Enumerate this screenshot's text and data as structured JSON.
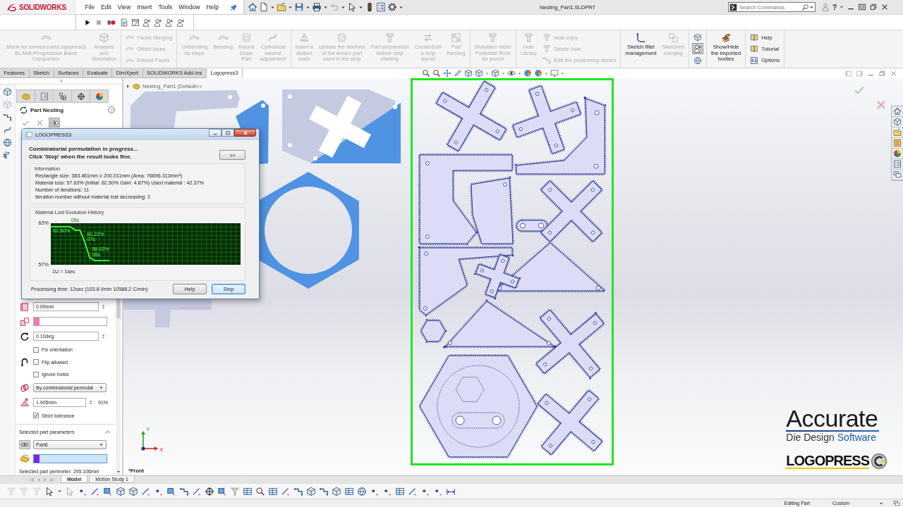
{
  "app_bar": {
    "logo": "SOLIDWORKS",
    "menus": [
      "File",
      "Edit",
      "View",
      "Insert",
      "Tools",
      "Window",
      "Help"
    ],
    "title": "Nesting_Part1.SLDPRT",
    "search": {
      "placeholder": "Search Commands"
    },
    "help": "?"
  },
  "ribbon": {
    "groups": [
      [
        {
          "kind": "large",
          "label": "Blank for formed part/Logopress3\nBLANK/Progressive Blank\nCompanion",
          "disabled": true
        },
        {
          "kind": "large",
          "label": "Analysis\nand\nSimulation",
          "disabled": true
        }
      ],
      [
        {
          "kind": "stack",
          "entries": [
            {
              "label": "Faces Merging",
              "disabled": true
            },
            {
              "label": "Offset faces",
              "disabled": true
            },
            {
              "label": "Extend Faces",
              "disabled": true
            }
          ]
        }
      ],
      [
        {
          "kind": "large",
          "label": "Unbending\nby steps",
          "disabled": true
        },
        {
          "kind": "large",
          "label": "Bending",
          "disabled": true
        },
        {
          "kind": "large",
          "label": "Round\nDraw\nPart",
          "disabled": true
        },
        {
          "kind": "large",
          "label": "Cylindrical\nvolume\nadjustment",
          "disabled": true
        }
      ],
      [
        {
          "kind": "large",
          "label": "Insert a\nstation\nmark",
          "disabled": true
        },
        {
          "kind": "large",
          "label": "Update the stations\nof the Annex part\nused in the strip",
          "disabled": true
        },
        {
          "kind": "large",
          "label": "Part preparation\nbefore strip\nstarting",
          "disabled": true
        },
        {
          "kind": "large",
          "label": "Create/Edit\na strip\nlayout",
          "disabled": true
        },
        {
          "kind": "large",
          "label": "Part\nNesting",
          "disabled": true
        }
      ],
      [
        {
          "kind": "large",
          "label": "Shoulder/ Heel/\nPedestal/ Roof\nfor punch",
          "disabled": true
        }
      ],
      [
        {
          "kind": "large",
          "label": "Hole\nLibrary",
          "disabled": true
        },
        {
          "kind": "stack",
          "entries": [
            {
              "label": "Hole copy",
              "disabled": true
            },
            {
              "label": "Delete hole",
              "disabled": true
            },
            {
              "label": "Edit the positioning sketch",
              "disabled": true
            }
          ]
        }
      ],
      [
        {
          "kind": "large",
          "label": "Sketch fillet\nmanagement",
          "disabled": false
        },
        {
          "kind": "large",
          "label": "Sketches\nmerging",
          "disabled": true
        }
      ],
      [
        {
          "kind": "toggles",
          "entries": [
            {
              "selected": false
            },
            {
              "selected": true
            },
            {
              "selected": false
            }
          ]
        }
      ],
      [
        {
          "kind": "large",
          "label": "Show/Hide\nthe imported\nbodies",
          "disabled": false
        }
      ],
      [
        {
          "kind": "stack",
          "entries": [
            {
              "label": "Help",
              "disabled": false
            },
            {
              "label": "Tutorial",
              "disabled": false
            },
            {
              "label": "Options",
              "disabled": false
            }
          ]
        }
      ]
    ]
  },
  "tabs": [
    {
      "label": "Features",
      "selected": false
    },
    {
      "label": "Sketch",
      "selected": false
    },
    {
      "label": "Surfaces",
      "selected": false
    },
    {
      "label": "Evaluate",
      "selected": false
    },
    {
      "label": "DimXpert",
      "selected": false
    },
    {
      "label": "SOLIDWORKS Add-Ins",
      "selected": false
    },
    {
      "label": "Logopress3",
      "selected": true
    }
  ],
  "property_manager": {
    "title": "Part Nesting",
    "help": "?",
    "actions": [
      {
        "kind": "ok",
        "disabled": true
      },
      {
        "kind": "cancel",
        "disabled": true
      },
      {
        "kind": "preview",
        "disabled": false
      }
    ],
    "fields": [
      {
        "kind": "spinner",
        "value": "0.00mm"
      },
      {
        "kind": "selection",
        "color": "#f07ab8",
        "active": false
      },
      {
        "kind": "spinner",
        "value": "0.10deg"
      },
      {
        "kind": "checkbox",
        "label": "Fix orientation",
        "checked": false
      },
      {
        "kind": "checkbox",
        "label": "Flip allowed",
        "checked": false
      },
      {
        "kind": "checkbox",
        "label": "Ignore holes",
        "checked": false
      },
      {
        "kind": "dropdown",
        "value": "By combinatorial permutal"
      },
      {
        "kind": "spinner",
        "value": "1.905mm",
        "suffix": "91%"
      },
      {
        "kind": "checkbox",
        "label": "Strict tolerance",
        "checked": true
      }
    ],
    "section": {
      "title": "Selected part parameters",
      "expanded": true,
      "part": "Part6",
      "selection": {
        "color": "#7d22e6",
        "active": true
      },
      "perimeter": "Selected part perimeter: 295.106mm"
    }
  },
  "dialog": {
    "title": "LOGOPRESS3",
    "message": [
      "Combinatorial permutation in progress...",
      "Click 'Stop' when the result looks fine."
    ],
    "expand_button": ">>",
    "info": {
      "title": "Information",
      "lines": [
        "Rectangle size: 383.461mm x 200.011mm (Area: 76696.313mm²)",
        "Material loss: 57.63% (Initial: 62.50% Gain: 4.87%) Used material : 42.37%",
        "Number of iterations: 11",
        "Iteration number without material lost decreasing: 1"
      ]
    },
    "history": {
      "title": "Material Lost Evolution History",
      "chart_data": {
        "type": "line",
        "grid": true,
        "categories": [
          null,
          null,
          null,
          null,
          null,
          "05s",
          null,
          null,
          null,
          null,
          null,
          null,
          null,
          null,
          null,
          null,
          null,
          null,
          null,
          null,
          null,
          null,
          null,
          null,
          null,
          null,
          null,
          null,
          null,
          null,
          null,
          null,
          null,
          null,
          null,
          null,
          null,
          null,
          null,
          null
        ],
        "values": [
          62.5,
          62.5,
          62.5,
          62.5,
          62.5,
          62.0,
          62.0,
          60.22,
          58.02,
          57.6,
          57.6,
          57.6,
          57.6,
          null,
          null,
          null,
          null,
          null,
          null,
          null,
          null,
          null,
          null,
          null,
          null,
          null,
          null,
          null,
          null,
          null,
          null,
          null,
          null,
          null,
          null,
          null,
          null,
          null,
          null,
          null
        ],
        "ylim": [
          57,
          63
        ],
        "yticks": [
          {
            "value": 63,
            "label": "63%"
          },
          {
            "value": 57,
            "label": "57%"
          }
        ],
        "value_labels": [
          "62.50%",
          null,
          null,
          null,
          null,
          null,
          null,
          "60.22% 07s",
          "58.02% 08s",
          null,
          null,
          null,
          null,
          null,
          null,
          null,
          null,
          null,
          null,
          null,
          null,
          null,
          null,
          null,
          null,
          null,
          null,
          null,
          null,
          null,
          null,
          null,
          null,
          null,
          null,
          null,
          null,
          null,
          null,
          null
        ]
      },
      "unit_note": "1U = 1sec"
    },
    "processing_time": "Processing time: 12sec (103.8 I/min 10588.2 C/min)",
    "buttons": [
      {
        "label": "Help",
        "focused": false
      },
      {
        "label": "Stop",
        "focused": true
      }
    ]
  },
  "graphics": {
    "tree_node": "Nesting_Part1 (Default<<",
    "view_label": "*Front",
    "axes": {
      "y": "Y",
      "x": "X"
    },
    "branding": {
      "name": "Accurate",
      "tagline": [
        "Die Design",
        "Software"
      ],
      "product": "LOGOPRESS"
    }
  },
  "model_tabs": [
    {
      "label": "Model",
      "selected": true
    },
    {
      "label": "Motion Study 1",
      "selected": false
    }
  ],
  "status_bar": {
    "mode": "Editing Part",
    "units": "Custom"
  }
}
